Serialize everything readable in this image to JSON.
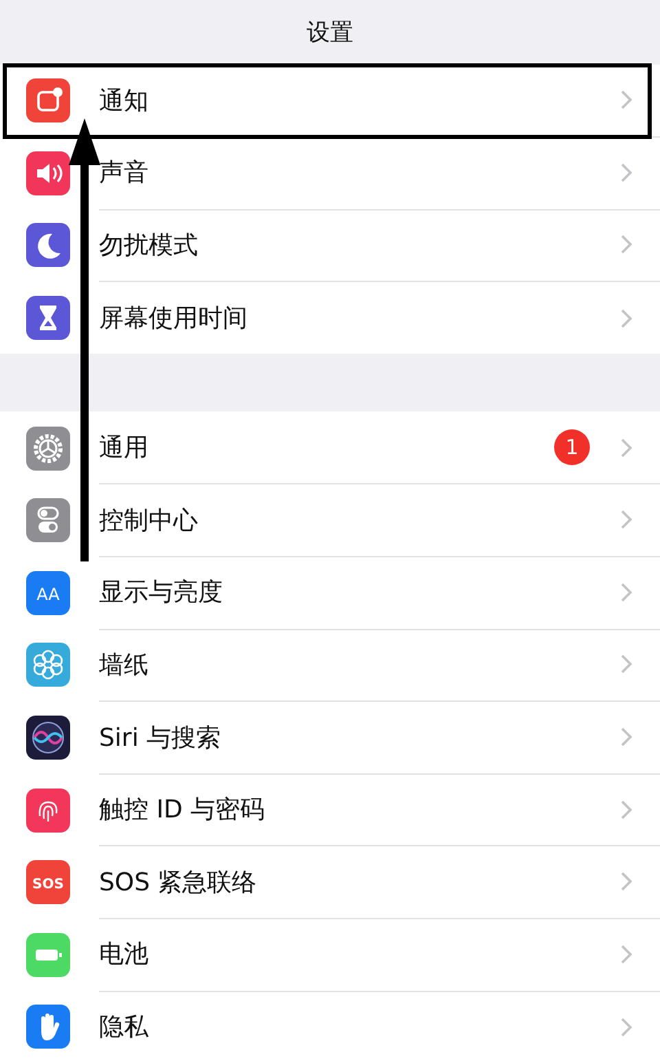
{
  "nav_bar": {
    "title": "设置"
  },
  "groups": [
    {
      "rows": [
        {
          "label": "通知"
        },
        {
          "label": "声音"
        },
        {
          "label": "勿扰模式"
        },
        {
          "label": "屏幕使用时间"
        }
      ]
    },
    {
      "rows": [
        {
          "label": "通用",
          "badge": "1"
        },
        {
          "label": "控制中心"
        },
        {
          "label": "显示与亮度",
          "icon_text": "AA"
        },
        {
          "label": "墙纸"
        },
        {
          "label": "Siri 与搜索"
        },
        {
          "label": "触控 ID 与密码"
        },
        {
          "label": "SOS 紧急联络",
          "icon_text": "SOS"
        },
        {
          "label": "电池"
        },
        {
          "label": "隐私"
        }
      ]
    }
  ],
  "annotations": {
    "highlight_box": true,
    "arrow": true
  }
}
